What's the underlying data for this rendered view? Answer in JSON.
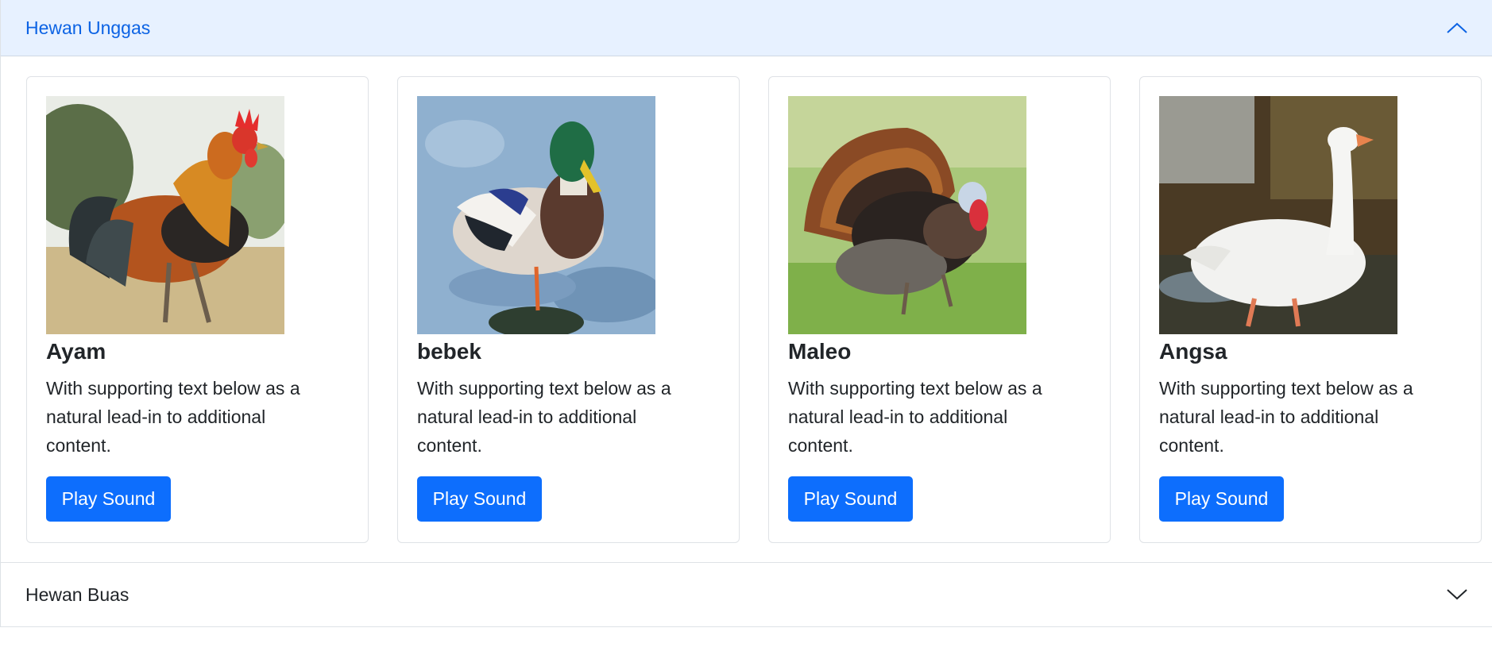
{
  "accordion": {
    "unggas": {
      "title": "Hewan Unggas",
      "expanded": true,
      "cards": [
        {
          "title": "Ayam",
          "text": "With supporting text below as a natural lead-in to additional content.",
          "button": "Play Sound",
          "image": "rooster-photo"
        },
        {
          "title": "bebek",
          "text": "With supporting text below as a natural lead-in to additional content.",
          "button": "Play Sound",
          "image": "mallard-duck-photo"
        },
        {
          "title": "Maleo",
          "text": "With supporting text below as a natural lead-in to additional content.",
          "button": "Play Sound",
          "image": "turkey-photo"
        },
        {
          "title": "Angsa",
          "text": "With supporting text below as a natural lead-in to additional content.",
          "button": "Play Sound",
          "image": "white-goose-photo"
        }
      ]
    },
    "buas": {
      "title": "Hewan Buas",
      "expanded": false
    }
  },
  "colors": {
    "accent": "#0d6efd",
    "header_active_bg": "#e7f1ff",
    "header_active_text": "#0c63e4",
    "border": "#dee2e6"
  },
  "icons": {
    "expanded": "chevron-up-icon",
    "collapsed": "chevron-down-icon"
  }
}
